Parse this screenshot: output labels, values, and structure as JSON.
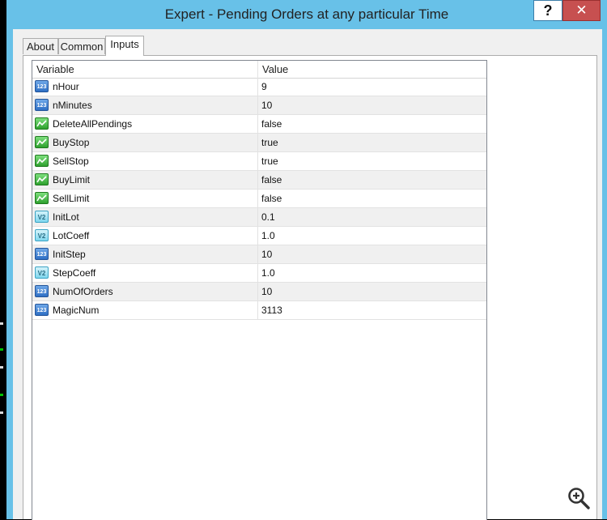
{
  "window": {
    "title": "Expert - Pending Orders at any particular Time",
    "help_label": "?",
    "close_label": "✕"
  },
  "tabs": [
    {
      "label": "About"
    },
    {
      "label": "Common"
    },
    {
      "label": "Inputs",
      "selected": true
    }
  ],
  "grid": {
    "columns": {
      "variable": "Variable",
      "value": "Value"
    },
    "rows": [
      {
        "name": "nHour",
        "value": "9",
        "type": "int",
        "icon": "integer-icon"
      },
      {
        "name": "nMinutes",
        "value": "10",
        "type": "int",
        "icon": "integer-icon"
      },
      {
        "name": "DeleteAllPendings",
        "value": "false",
        "type": "bool",
        "icon": "boolean-icon"
      },
      {
        "name": "BuyStop",
        "value": "true",
        "type": "bool",
        "icon": "boolean-icon"
      },
      {
        "name": "SellStop",
        "value": "true",
        "type": "bool",
        "icon": "boolean-icon"
      },
      {
        "name": "BuyLimit",
        "value": "false",
        "type": "bool",
        "icon": "boolean-icon"
      },
      {
        "name": "SellLimit",
        "value": "false",
        "type": "bool",
        "icon": "boolean-icon"
      },
      {
        "name": "InitLot",
        "value": "0.1",
        "type": "dbl",
        "icon": "double-icon"
      },
      {
        "name": "LotCoeff",
        "value": "1.0",
        "type": "dbl",
        "icon": "double-icon"
      },
      {
        "name": "InitStep",
        "value": "10",
        "type": "int",
        "icon": "integer-icon"
      },
      {
        "name": "StepCoeff",
        "value": "1.0",
        "type": "dbl",
        "icon": "double-icon"
      },
      {
        "name": "NumOfOrders",
        "value": "10",
        "type": "int",
        "icon": "integer-icon"
      },
      {
        "name": "MagicNum",
        "value": "3113",
        "type": "int",
        "icon": "integer-icon"
      }
    ]
  },
  "icon_glyphs": {
    "int": "123",
    "dbl": "V2"
  },
  "colors": {
    "window_frame": "#68c1e8",
    "close_button": "#c75050",
    "alt_row": "#f0f0f0"
  },
  "overlay": {
    "zoom_icon": "zoom-in-icon"
  }
}
